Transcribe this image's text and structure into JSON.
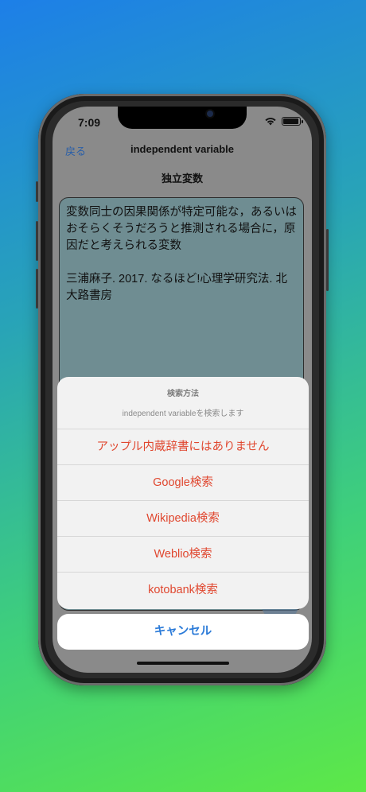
{
  "status": {
    "time": "7:09"
  },
  "nav": {
    "back_label": "戻る",
    "title": "independent variable"
  },
  "subtitle": "独立変数",
  "content": {
    "definition": "変数同士の因果関係が特定可能な，あるいはおそらくそうだろうと推測される場合に，原因だと考えられる変数",
    "reference": "三浦麻子. 2017. なるほど!心理学研究法. 北大路書房"
  },
  "action_sheet": {
    "title": "検索方法",
    "message": "independent variableを検索します",
    "options": [
      "アップル内蔵辞書にはありません",
      "Google検索",
      "Wikipedia検索",
      "Weblio検索",
      "kotobank検索"
    ],
    "cancel_label": "キャンセル"
  },
  "colors": {
    "accent_red": "#e0472f",
    "accent_blue": "#2a7ad8"
  }
}
